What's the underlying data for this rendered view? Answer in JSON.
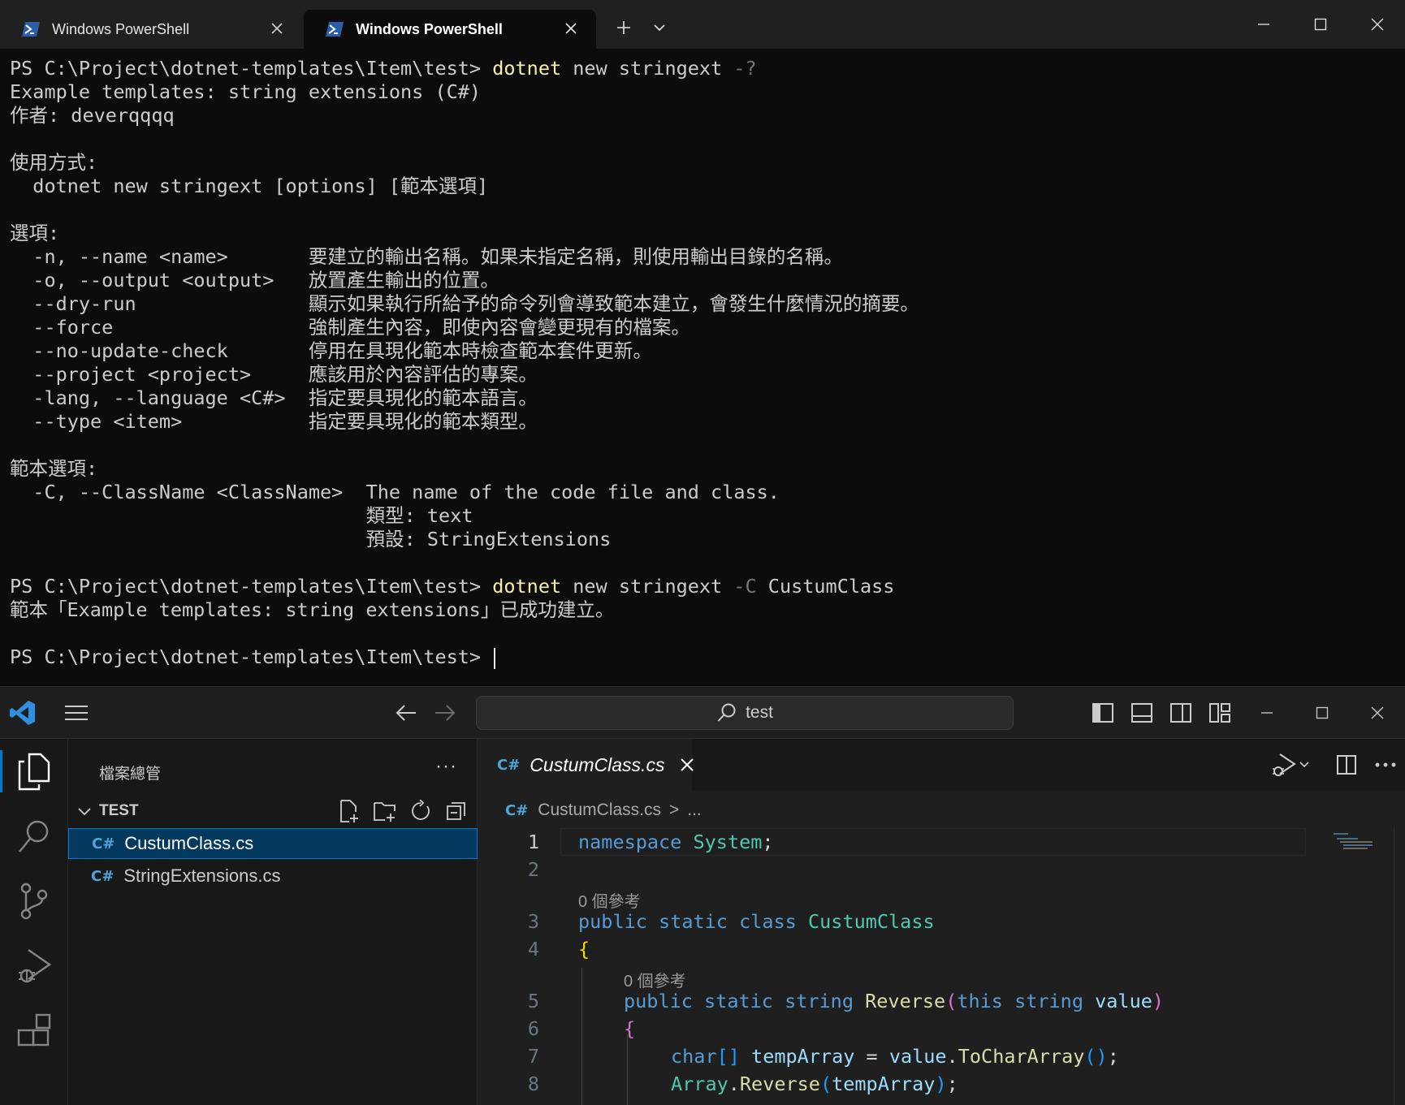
{
  "terminal": {
    "tabs": [
      {
        "label": "Windows PowerShell",
        "active": false
      },
      {
        "label": "Windows PowerShell",
        "active": true
      }
    ],
    "new_tab": "+",
    "lines": [
      {
        "prompt": "PS C:\\Project\\dotnet-templates\\Item\\test> ",
        "cmd": "dotnet",
        "rest": " new stringext ",
        "flag": "-?"
      },
      {
        "text": "Example templates: string extensions (C#)"
      },
      {
        "text": "作者: deverqqqq"
      },
      {
        "text": ""
      },
      {
        "text": "使用方式:"
      },
      {
        "text": "  dotnet new stringext [options] [範本選項]"
      },
      {
        "text": ""
      },
      {
        "text": "選項:"
      },
      {
        "text": "  -n, --name <name>       要建立的輸出名稱。如果未指定名稱，則使用輸出目錄的名稱。"
      },
      {
        "text": "  -o, --output <output>   放置產生輸出的位置。"
      },
      {
        "text": "  --dry-run               顯示如果執行所給予的命令列會導致範本建立，會發生什麼情況的摘要。"
      },
      {
        "text": "  --force                 強制產生內容，即使內容會變更現有的檔案。"
      },
      {
        "text": "  --no-update-check       停用在具現化範本時檢查範本套件更新。"
      },
      {
        "text": "  --project <project>     應該用於內容評估的專案。"
      },
      {
        "text": "  -lang, --language <C#>  指定要具現化的範本語言。"
      },
      {
        "text": "  --type <item>           指定要具現化的範本類型。"
      },
      {
        "text": ""
      },
      {
        "text": "範本選項:"
      },
      {
        "text": "  -C, --ClassName <ClassName>  The name of the code file and class."
      },
      {
        "text": "                               類型: text"
      },
      {
        "text": "                               預設: StringExtensions"
      },
      {
        "text": ""
      },
      {
        "prompt": "PS C:\\Project\\dotnet-templates\\Item\\test> ",
        "cmd": "dotnet",
        "rest": " new stringext ",
        "flag": "-C",
        "rest2": " CustumClass"
      },
      {
        "text": "範本「Example templates: string extensions」已成功建立。"
      },
      {
        "text": ""
      },
      {
        "prompt": "PS C:\\Project\\dotnet-templates\\Item\\test> ",
        "cursor": true
      }
    ]
  },
  "vscode": {
    "search": "test",
    "explorer": {
      "title": "檔案總管",
      "more": "···",
      "section": "TEST",
      "files": [
        {
          "name": "CustumClass.cs",
          "badge": "C#",
          "selected": true
        },
        {
          "name": "StringExtensions.cs",
          "badge": "C#",
          "selected": false
        }
      ]
    },
    "editor": {
      "tab": {
        "label": "CustumClass.cs",
        "badge": "C#"
      },
      "breadcrumb": {
        "file": "CustumClass.cs",
        "sep": ">",
        "rest": "..."
      },
      "codelens": "0 個參考",
      "line_numbers": [
        "1",
        "2",
        "3",
        "4",
        "5",
        "6",
        "7",
        "8"
      ],
      "code": {
        "l1": {
          "kw": "namespace",
          "ty": "System",
          "end": ";"
        },
        "l3": {
          "k1": "public",
          "k2": "static",
          "k3": "class",
          "ty": "CustumClass"
        },
        "l4": {
          "br": "{"
        },
        "l5": {
          "k1": "public",
          "k2": "static",
          "k3": "string",
          "fn": "Reverse",
          "op": "(",
          "k4": "this",
          "k5": "string",
          "pa": "value",
          "cp": ")"
        },
        "l6": {
          "br": "{"
        },
        "l7": {
          "k1": "char",
          "ab": "[]",
          "v": "tempArray",
          "eq": " = ",
          "v2": "value",
          "dot": ".",
          "fn": "ToCharArray",
          "op": "()",
          "end": ";"
        },
        "l8": {
          "ty": "Array",
          "dot": ".",
          "fn": "Reverse",
          "op": "(",
          "v": "tempArray",
          "cp": ")",
          "end": ";"
        }
      }
    }
  },
  "colors": {
    "terminal_bg": "#0c0c0c",
    "command": "#f9f1a5",
    "accent": "#0078d4",
    "keyword": "#569cd6",
    "type": "#4ec9b0"
  }
}
